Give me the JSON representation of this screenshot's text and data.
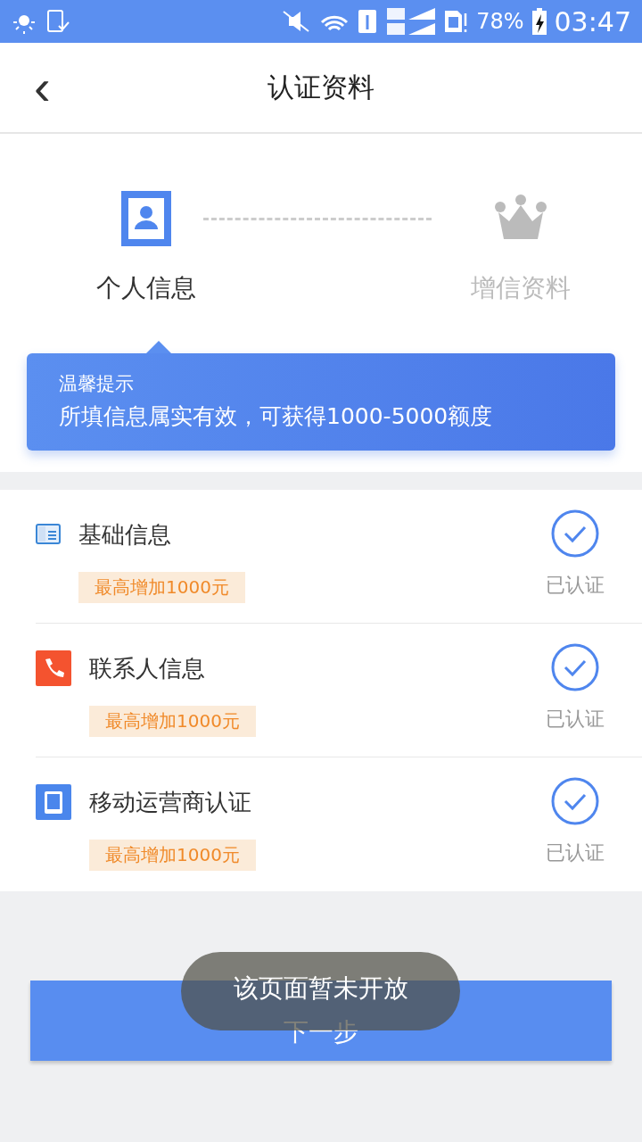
{
  "status_bar": {
    "battery": "78%",
    "time": "03:47"
  },
  "header": {
    "back": "‹",
    "title": "认证资料"
  },
  "steps": [
    {
      "label": "个人信息",
      "kind": "profile",
      "selected": true
    },
    {
      "label": "增信资料",
      "kind": "crown",
      "selected": false
    }
  ],
  "tip": {
    "title": "温馨提示",
    "text": "所填信息属实有效，可获得1000-5000额度"
  },
  "items": [
    {
      "kind": "card",
      "title": "基础信息",
      "tag": "最高增加1000元",
      "verified": true,
      "status": "已认证"
    },
    {
      "kind": "phone",
      "title": "联系人信息",
      "tag": "最高增加1000元",
      "verified": true,
      "status": "已认证"
    },
    {
      "kind": "tablet",
      "title": "移动运营商认证",
      "tag": "最高增加1000元",
      "verified": true,
      "status": "已认证"
    }
  ],
  "next_button": "下一步",
  "toast": "该页面暂未开放"
}
